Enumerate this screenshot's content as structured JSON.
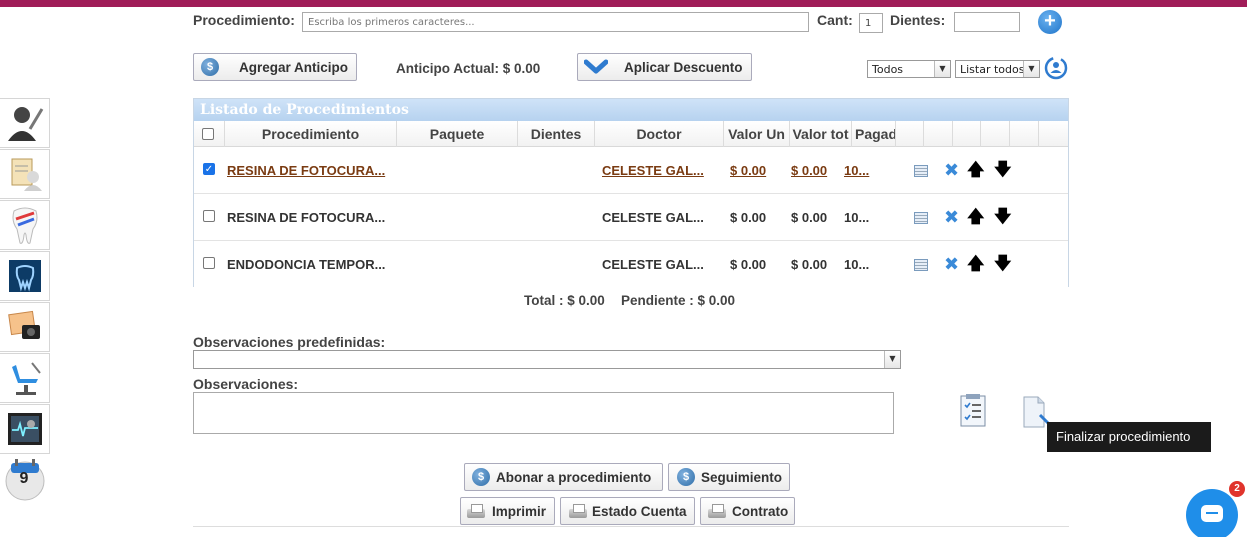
{
  "header": {
    "procedimiento_label": "Procedimiento:",
    "procedimiento_placeholder": "Escriba los primeros caracteres...",
    "cant_label": "Cant:",
    "cant_value": "1",
    "dientes_label": "Dientes:",
    "dientes_value": ""
  },
  "toolbar": {
    "agregar_anticipo": "Agregar Anticipo",
    "anticipo_actual": "Anticipo Actual: $ 0.00",
    "aplicar_descuento": "Aplicar Descuento",
    "filter_1": "Todos",
    "filter_2": "Listar todos"
  },
  "sidebar": {
    "calendar_day": "9"
  },
  "grid": {
    "caption": "Listado de Procedimientos",
    "columns": [
      "Procedimiento",
      "Paquete",
      "Dientes",
      "Doctor",
      "Valor Un",
      "Valor tot",
      "Pagad"
    ],
    "rows": [
      {
        "checked": true,
        "procedimiento": "RESINA DE FOTOCURA...",
        "paquete": "",
        "dientes": "",
        "doctor": "CELESTE GAL...",
        "valor_un": "$ 0.00",
        "valor_tot": "$ 0.00",
        "pagado": "10..."
      },
      {
        "checked": false,
        "procedimiento": "RESINA DE FOTOCURA...",
        "paquete": "",
        "dientes": "",
        "doctor": "CELESTE GAL...",
        "valor_un": "$ 0.00",
        "valor_tot": "$ 0.00",
        "pagado": "10..."
      },
      {
        "checked": false,
        "procedimiento": "ENDODONCIA TEMPOR...",
        "paquete": "",
        "dientes": "",
        "doctor": "CELESTE GAL...",
        "valor_un": "$ 0.00",
        "valor_tot": "$ 0.00",
        "pagado": "10..."
      }
    ]
  },
  "totals": {
    "total": "Total : $ 0.00",
    "pendiente": "Pendiente : $ 0.00"
  },
  "observaciones": {
    "predefinidas_label": "Observaciones predefinidas:",
    "predefinidas_value": "",
    "label": "Observaciones:",
    "value": ""
  },
  "tooltip": "Finalizar procedimiento",
  "actions": {
    "abonar": "Abonar a procedimiento",
    "seguimiento": "Seguimiento",
    "imprimir": "Imprimir",
    "estado_cuenta": "Estado Cuenta",
    "contrato": "Contrato"
  },
  "chat": {
    "badge_count": "2"
  },
  "colors": {
    "topbar": "#a01c58",
    "grid_caption": "#b6d2ef",
    "link": "#7a3b12",
    "accent_blue": "#1f8ee9"
  }
}
